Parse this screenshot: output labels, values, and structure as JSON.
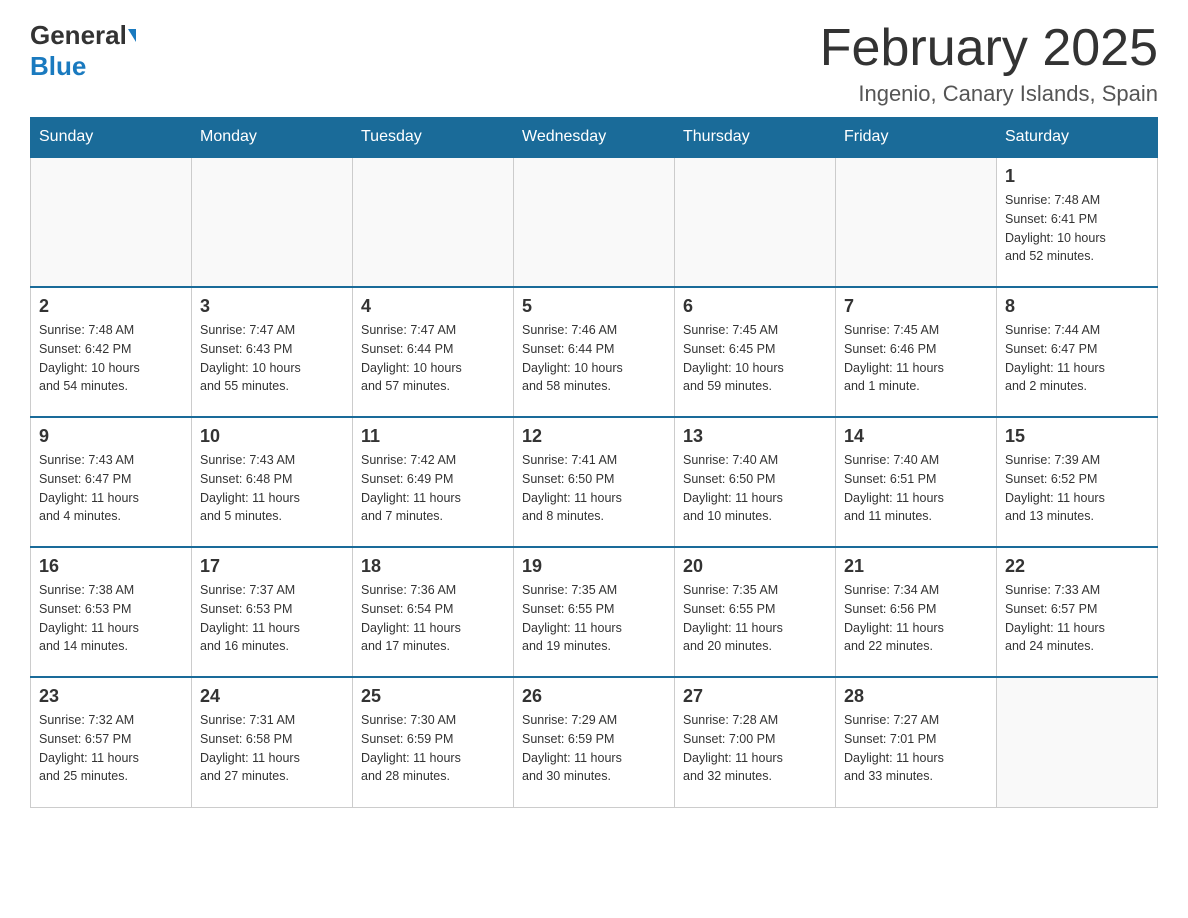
{
  "header": {
    "logo_general": "General",
    "logo_blue": "Blue",
    "month_title": "February 2025",
    "location": "Ingenio, Canary Islands, Spain"
  },
  "weekdays": [
    "Sunday",
    "Monday",
    "Tuesday",
    "Wednesday",
    "Thursday",
    "Friday",
    "Saturday"
  ],
  "weeks": [
    [
      {
        "day": "",
        "info": ""
      },
      {
        "day": "",
        "info": ""
      },
      {
        "day": "",
        "info": ""
      },
      {
        "day": "",
        "info": ""
      },
      {
        "day": "",
        "info": ""
      },
      {
        "day": "",
        "info": ""
      },
      {
        "day": "1",
        "info": "Sunrise: 7:48 AM\nSunset: 6:41 PM\nDaylight: 10 hours\nand 52 minutes."
      }
    ],
    [
      {
        "day": "2",
        "info": "Sunrise: 7:48 AM\nSunset: 6:42 PM\nDaylight: 10 hours\nand 54 minutes."
      },
      {
        "day": "3",
        "info": "Sunrise: 7:47 AM\nSunset: 6:43 PM\nDaylight: 10 hours\nand 55 minutes."
      },
      {
        "day": "4",
        "info": "Sunrise: 7:47 AM\nSunset: 6:44 PM\nDaylight: 10 hours\nand 57 minutes."
      },
      {
        "day": "5",
        "info": "Sunrise: 7:46 AM\nSunset: 6:44 PM\nDaylight: 10 hours\nand 58 minutes."
      },
      {
        "day": "6",
        "info": "Sunrise: 7:45 AM\nSunset: 6:45 PM\nDaylight: 10 hours\nand 59 minutes."
      },
      {
        "day": "7",
        "info": "Sunrise: 7:45 AM\nSunset: 6:46 PM\nDaylight: 11 hours\nand 1 minute."
      },
      {
        "day": "8",
        "info": "Sunrise: 7:44 AM\nSunset: 6:47 PM\nDaylight: 11 hours\nand 2 minutes."
      }
    ],
    [
      {
        "day": "9",
        "info": "Sunrise: 7:43 AM\nSunset: 6:47 PM\nDaylight: 11 hours\nand 4 minutes."
      },
      {
        "day": "10",
        "info": "Sunrise: 7:43 AM\nSunset: 6:48 PM\nDaylight: 11 hours\nand 5 minutes."
      },
      {
        "day": "11",
        "info": "Sunrise: 7:42 AM\nSunset: 6:49 PM\nDaylight: 11 hours\nand 7 minutes."
      },
      {
        "day": "12",
        "info": "Sunrise: 7:41 AM\nSunset: 6:50 PM\nDaylight: 11 hours\nand 8 minutes."
      },
      {
        "day": "13",
        "info": "Sunrise: 7:40 AM\nSunset: 6:50 PM\nDaylight: 11 hours\nand 10 minutes."
      },
      {
        "day": "14",
        "info": "Sunrise: 7:40 AM\nSunset: 6:51 PM\nDaylight: 11 hours\nand 11 minutes."
      },
      {
        "day": "15",
        "info": "Sunrise: 7:39 AM\nSunset: 6:52 PM\nDaylight: 11 hours\nand 13 minutes."
      }
    ],
    [
      {
        "day": "16",
        "info": "Sunrise: 7:38 AM\nSunset: 6:53 PM\nDaylight: 11 hours\nand 14 minutes."
      },
      {
        "day": "17",
        "info": "Sunrise: 7:37 AM\nSunset: 6:53 PM\nDaylight: 11 hours\nand 16 minutes."
      },
      {
        "day": "18",
        "info": "Sunrise: 7:36 AM\nSunset: 6:54 PM\nDaylight: 11 hours\nand 17 minutes."
      },
      {
        "day": "19",
        "info": "Sunrise: 7:35 AM\nSunset: 6:55 PM\nDaylight: 11 hours\nand 19 minutes."
      },
      {
        "day": "20",
        "info": "Sunrise: 7:35 AM\nSunset: 6:55 PM\nDaylight: 11 hours\nand 20 minutes."
      },
      {
        "day": "21",
        "info": "Sunrise: 7:34 AM\nSunset: 6:56 PM\nDaylight: 11 hours\nand 22 minutes."
      },
      {
        "day": "22",
        "info": "Sunrise: 7:33 AM\nSunset: 6:57 PM\nDaylight: 11 hours\nand 24 minutes."
      }
    ],
    [
      {
        "day": "23",
        "info": "Sunrise: 7:32 AM\nSunset: 6:57 PM\nDaylight: 11 hours\nand 25 minutes."
      },
      {
        "day": "24",
        "info": "Sunrise: 7:31 AM\nSunset: 6:58 PM\nDaylight: 11 hours\nand 27 minutes."
      },
      {
        "day": "25",
        "info": "Sunrise: 7:30 AM\nSunset: 6:59 PM\nDaylight: 11 hours\nand 28 minutes."
      },
      {
        "day": "26",
        "info": "Sunrise: 7:29 AM\nSunset: 6:59 PM\nDaylight: 11 hours\nand 30 minutes."
      },
      {
        "day": "27",
        "info": "Sunrise: 7:28 AM\nSunset: 7:00 PM\nDaylight: 11 hours\nand 32 minutes."
      },
      {
        "day": "28",
        "info": "Sunrise: 7:27 AM\nSunset: 7:01 PM\nDaylight: 11 hours\nand 33 minutes."
      },
      {
        "day": "",
        "info": ""
      }
    ]
  ]
}
